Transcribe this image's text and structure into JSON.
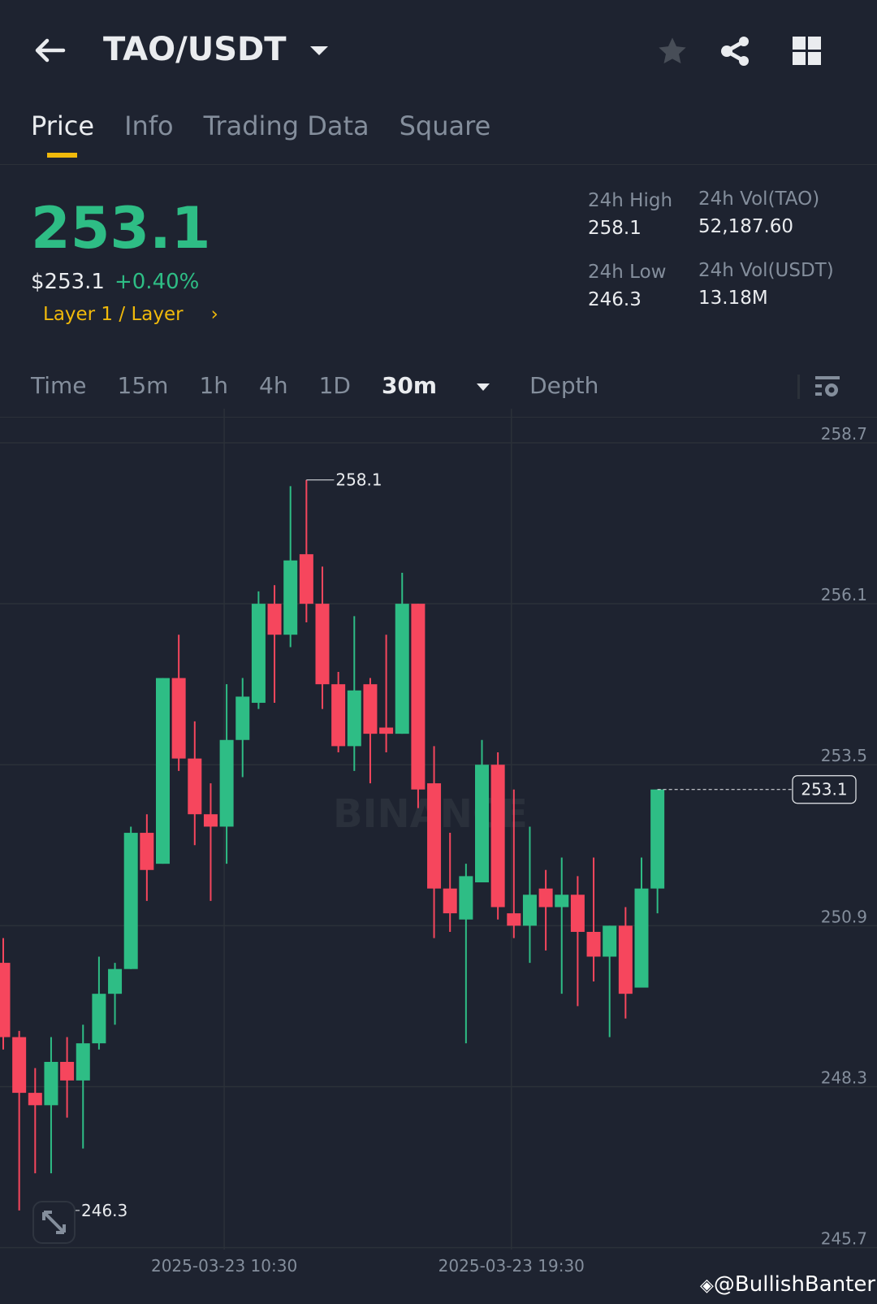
{
  "header": {
    "title": "TAO/USDT",
    "icons": [
      "back-arrow-icon",
      "caret-down-icon",
      "star-icon",
      "share-icon",
      "grid-icon"
    ]
  },
  "tabs": [
    {
      "label": "Price"
    },
    {
      "label": "Info"
    },
    {
      "label": "Trading Data"
    },
    {
      "label": "Square"
    }
  ],
  "ticker": {
    "last": "253.1",
    "usd": "$253.1",
    "change": "+0.40%",
    "category": "Layer 1 / Layer",
    "category_arrow": "›",
    "high_label": "24h High",
    "high": "258.1",
    "low_label": "24h Low",
    "low": "246.3",
    "vol_base_label": "24h Vol(TAO)",
    "vol_base": "52,187.60",
    "vol_quote_label": "24h Vol(USDT)",
    "vol_quote": "13.18M"
  },
  "toolbar": {
    "items": [
      "Time",
      "15m",
      "1h",
      "4h",
      "1D"
    ],
    "active": "30m",
    "depth": "Depth"
  },
  "colors": {
    "up": "#2ebd85",
    "down": "#f6465d",
    "accent": "#f0b90b"
  },
  "watermark": "BINANCE",
  "credit": "@BullishBanter",
  "chart_data": {
    "type": "candlestick",
    "interval": "30m",
    "y_ticks": [
      "258.7",
      "256.1",
      "253.5",
      "250.9",
      "248.3",
      "245.7"
    ],
    "ylim": [
      245.7,
      258.7
    ],
    "x_ticks": [
      {
        "label": "2025-03-23 10:30",
        "index": 14
      },
      {
        "label": "2025-03-23 19:30",
        "index": 32
      }
    ],
    "high_marker": {
      "label": "258.1",
      "index": 19
    },
    "low_marker": {
      "label": "246.3",
      "index": 1
    },
    "last_price": "253.1",
    "candles": [
      [
        250.3,
        250.7,
        248.9,
        249.1
      ],
      [
        249.1,
        249.2,
        246.3,
        248.2
      ],
      [
        248.2,
        248.6,
        246.9,
        248.0
      ],
      [
        248.0,
        249.1,
        246.9,
        248.7
      ],
      [
        248.7,
        249.1,
        247.8,
        248.4
      ],
      [
        248.4,
        249.3,
        247.3,
        249.0
      ],
      [
        249.0,
        250.4,
        248.9,
        249.8
      ],
      [
        249.8,
        250.3,
        249.3,
        250.2
      ],
      [
        250.2,
        252.5,
        250.2,
        252.4
      ],
      [
        252.4,
        252.7,
        251.3,
        251.8
      ],
      [
        251.9,
        254.9,
        251.9,
        254.9
      ],
      [
        254.9,
        255.6,
        253.4,
        253.6
      ],
      [
        253.6,
        254.2,
        252.2,
        252.7
      ],
      [
        252.7,
        253.2,
        251.3,
        252.5
      ],
      [
        252.5,
        254.8,
        251.9,
        253.9
      ],
      [
        253.9,
        254.9,
        253.3,
        254.6
      ],
      [
        254.5,
        256.3,
        254.4,
        256.1
      ],
      [
        256.1,
        256.4,
        254.5,
        255.6
      ],
      [
        255.6,
        258.0,
        255.4,
        256.8
      ],
      [
        256.9,
        258.1,
        255.8,
        256.1
      ],
      [
        256.1,
        256.7,
        254.4,
        254.8
      ],
      [
        254.8,
        255.0,
        253.7,
        253.8
      ],
      [
        253.8,
        255.9,
        253.4,
        254.7
      ],
      [
        254.8,
        254.9,
        253.2,
        254.0
      ],
      [
        254.1,
        255.6,
        253.7,
        254.0
      ],
      [
        254.0,
        256.6,
        254.0,
        256.1
      ],
      [
        256.1,
        256.1,
        252.8,
        253.1
      ],
      [
        253.2,
        253.8,
        250.7,
        251.5
      ],
      [
        251.5,
        252.4,
        250.8,
        251.1
      ],
      [
        251.0,
        251.9,
        249.0,
        251.7
      ],
      [
        251.6,
        253.9,
        251.6,
        253.5
      ],
      [
        253.5,
        253.7,
        251.0,
        251.2
      ],
      [
        251.1,
        253.1,
        250.7,
        250.9
      ],
      [
        250.9,
        252.5,
        250.3,
        251.4
      ],
      [
        251.5,
        251.8,
        250.5,
        251.2
      ],
      [
        251.2,
        252.0,
        249.8,
        251.4
      ],
      [
        251.4,
        251.7,
        249.6,
        250.8
      ],
      [
        250.8,
        252.0,
        250.0,
        250.4
      ],
      [
        250.4,
        250.9,
        249.1,
        250.9
      ],
      [
        250.9,
        251.2,
        249.4,
        249.8
      ],
      [
        249.9,
        252.0,
        249.9,
        251.5
      ],
      [
        251.5,
        253.1,
        251.1,
        253.1
      ]
    ]
  }
}
